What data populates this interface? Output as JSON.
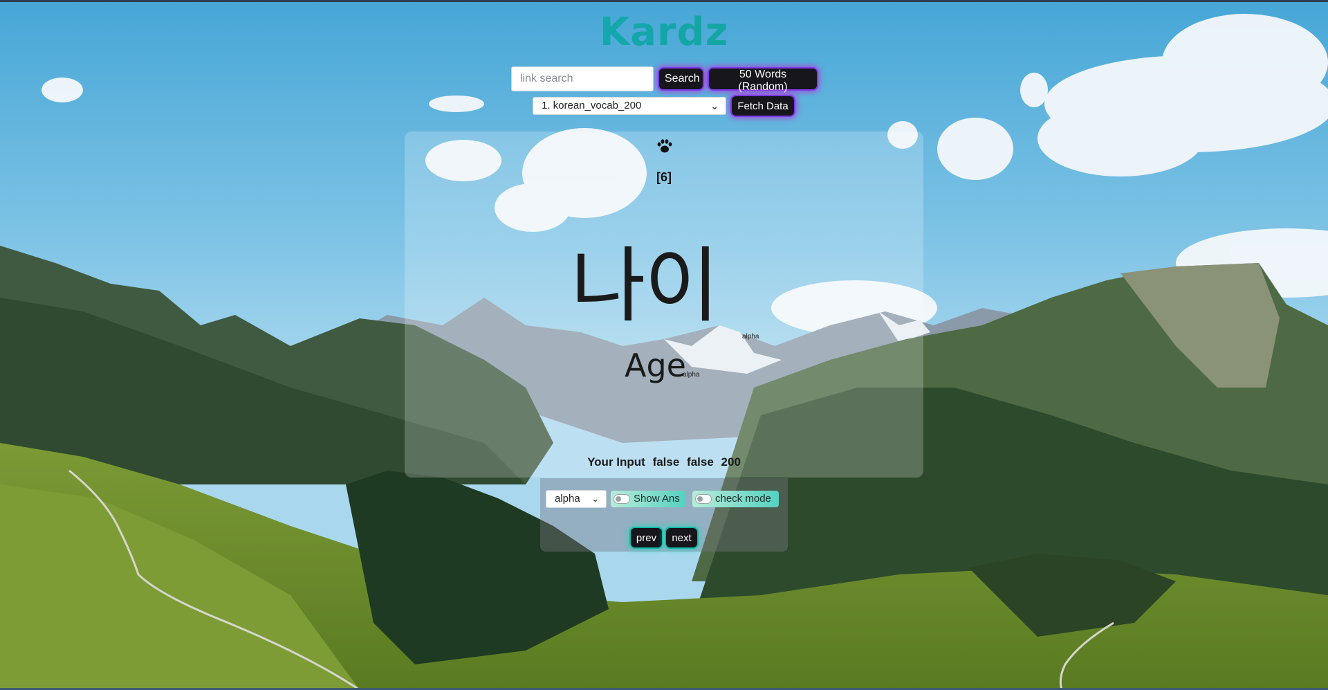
{
  "app": {
    "title": "Kardz"
  },
  "search": {
    "placeholder": "link search",
    "value": "",
    "button_label": "Search",
    "random_label": "50 Words (Random)"
  },
  "dataset": {
    "selected": "1. korean_vocab_200",
    "fetch_label": "Fetch Data"
  },
  "card": {
    "index_label": "[6]",
    "word": "나이",
    "word_tag": "alpha",
    "answer": "Age",
    "answer_tag": "alpha",
    "status": {
      "label": "Your Input",
      "value1": "false",
      "value2": "false",
      "value3": "200"
    }
  },
  "controls": {
    "mode_selected": "alpha",
    "show_ans_label": "Show Ans",
    "show_ans_on": false,
    "check_mode_label": "check mode",
    "check_mode_on": false,
    "prev_label": "prev",
    "next_label": "next"
  },
  "icons": {
    "card_icon": "paw-icon",
    "select_chevron": "chevron-down-icon"
  },
  "colors": {
    "title_gradient": [
      "#18b6d9",
      "#16a063"
    ],
    "button_bg": "#16161c",
    "glow_purple": "#c026d3",
    "glow_teal": "#2dd4bf"
  }
}
